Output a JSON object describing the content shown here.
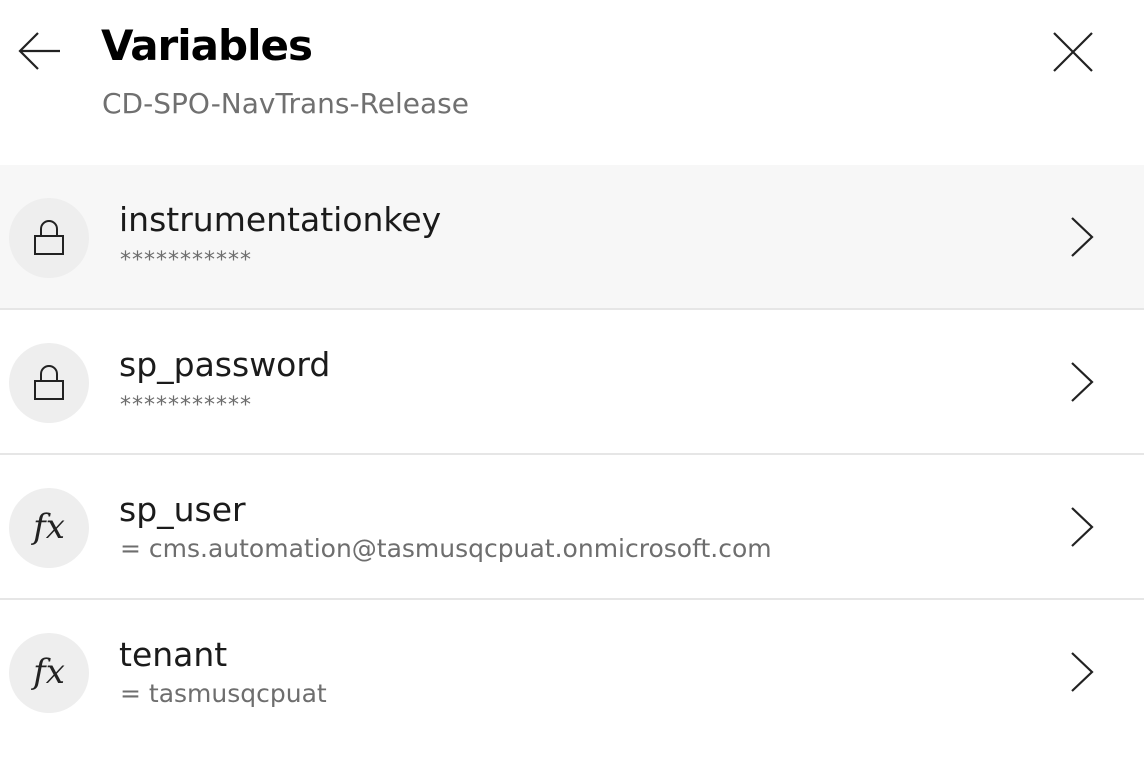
{
  "header": {
    "title": "Variables",
    "subtitle": "CD-SPO-NavTrans-Release",
    "back_icon": "arrow-left-icon",
    "close_icon": "close-icon"
  },
  "variables": [
    {
      "name": "instrumentationkey",
      "value": "***********",
      "icon": "lock-icon",
      "secret": true,
      "selected": true
    },
    {
      "name": "sp_password",
      "value": "***********",
      "icon": "lock-icon",
      "secret": true,
      "selected": false
    },
    {
      "name": "sp_user",
      "value": "= cms.automation@tasmusqcpuat.onmicrosoft.com",
      "icon": "fx-icon",
      "icon_text": "fx",
      "secret": false,
      "selected": false
    },
    {
      "name": "tenant",
      "value": "= tasmusqcpuat",
      "icon": "fx-icon",
      "icon_text": "fx",
      "secret": false,
      "selected": false
    }
  ],
  "colors": {
    "selected_row_bg": "#f7f7f7",
    "avatar_bg": "#eeeeee",
    "divider": "#e6e6e6",
    "secondary_text": "#707070"
  }
}
